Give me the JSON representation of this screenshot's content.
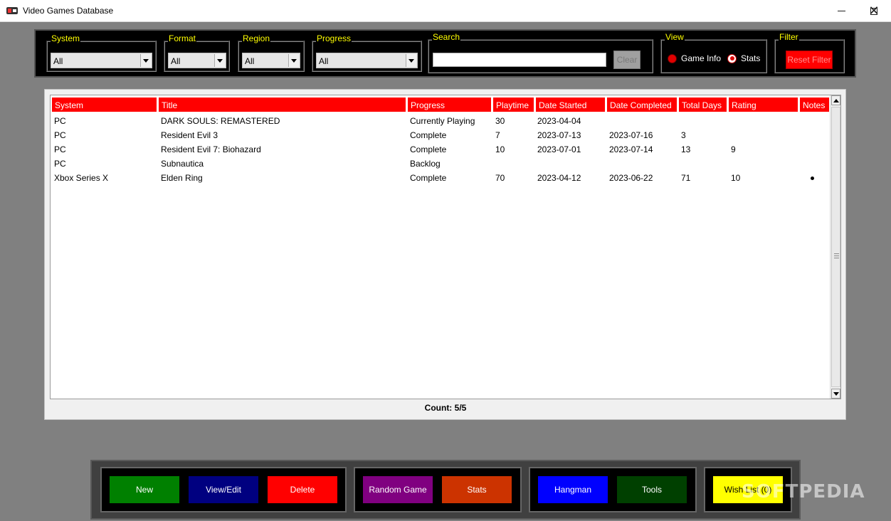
{
  "window": {
    "title": "Video Games Database"
  },
  "filters": {
    "system": {
      "label": "System",
      "value": "All"
    },
    "format": {
      "label": "Format",
      "value": "All"
    },
    "region": {
      "label": "Region",
      "value": "All"
    },
    "progress": {
      "label": "Progress",
      "value": "All"
    },
    "search": {
      "label": "Search",
      "value": "",
      "clear_label": "Clear"
    },
    "view": {
      "label": "View",
      "options": [
        "Game Info",
        "Stats"
      ],
      "selected": "Stats"
    },
    "filter": {
      "label": "Filter",
      "reset_label": "Reset Filter"
    }
  },
  "table": {
    "columns": [
      "System",
      "Title",
      "Progress",
      "Playtime",
      "Date Started",
      "Date Completed",
      "Total Days",
      "Rating",
      "Notes"
    ],
    "rows": [
      {
        "system": "PC",
        "title": "DARK SOULS: REMASTERED",
        "progress": "Currently Playing",
        "playtime": "30",
        "date_started": "2023-04-04",
        "date_completed": "",
        "total_days": "",
        "rating": "",
        "notes": false
      },
      {
        "system": "PC",
        "title": "Resident Evil 3",
        "progress": "Complete",
        "playtime": "7",
        "date_started": "2023-07-13",
        "date_completed": "2023-07-16",
        "total_days": "3",
        "rating": "",
        "notes": false
      },
      {
        "system": "PC",
        "title": "Resident Evil 7: Biohazard",
        "progress": "Complete",
        "playtime": "10",
        "date_started": "2023-07-01",
        "date_completed": "2023-07-14",
        "total_days": "13",
        "rating": "9",
        "notes": false
      },
      {
        "system": "PC",
        "title": "Subnautica",
        "progress": "Backlog",
        "playtime": "",
        "date_started": "",
        "date_completed": "",
        "total_days": "",
        "rating": "",
        "notes": false
      },
      {
        "system": "Xbox Series X",
        "title": "Elden Ring",
        "progress": "Complete",
        "playtime": "70",
        "date_started": "2023-04-12",
        "date_completed": "2023-06-22",
        "total_days": "71",
        "rating": "10",
        "notes": true
      }
    ],
    "count_text": "Count: 5/5"
  },
  "actions": {
    "new": "New",
    "view_edit": "View/Edit",
    "delete": "Delete",
    "random_game": "Random Game",
    "stats": "Stats",
    "hangman": "Hangman",
    "tools": "Tools",
    "wish_list": "Wish List (0)"
  },
  "colors": {
    "accent": "#ff0000",
    "label_yellow": "#ffff00",
    "new": "#008000",
    "view_edit": "#000080",
    "delete": "#ff0000",
    "random_game": "#800080",
    "stats": "#cc3300",
    "hangman": "#0000ff",
    "tools": "#004000",
    "wish_list": "#ffff00"
  },
  "watermark": "SOFTPEDIA"
}
